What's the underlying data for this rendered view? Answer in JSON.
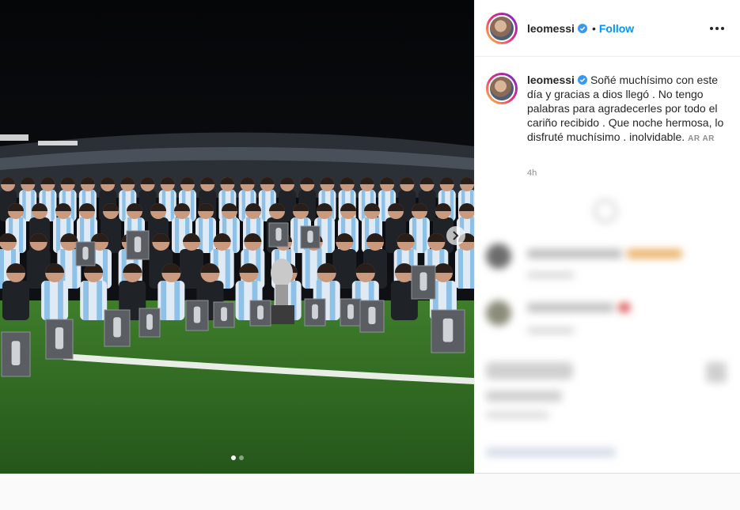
{
  "post": {
    "username": "leomessi",
    "follow_separator": "•",
    "follow_label": "Follow",
    "caption_text": "Soñé muchísimo con este día y gracias a dios llegó . No tengo palabras para agradecerles por todo el cariño recibido . Que noche hermosa, lo disfruté muchísimo . inolvidable.",
    "caption_tags": "AR AR",
    "timestamp": "4h"
  },
  "media": {
    "scene": "argentina-team-celebration-photo",
    "carousel_dots": 2,
    "active_dot": 0
  },
  "colors": {
    "follow_blue": "#0095f6",
    "verified_blue": "#3897f0",
    "pitch_green": "#2f6b1f",
    "jersey_blue": "#8ec1e8"
  }
}
